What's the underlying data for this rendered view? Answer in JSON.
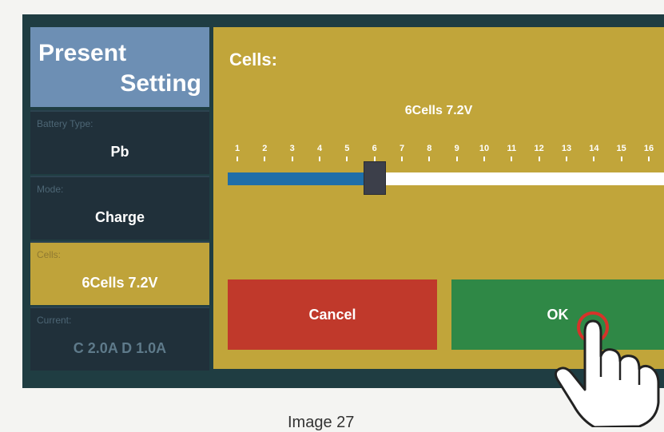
{
  "sidebar": {
    "header_line1": "Present",
    "header_line2": "Setting",
    "items": [
      {
        "label": "Battery Type:",
        "value": "Pb"
      },
      {
        "label": "Mode:",
        "value": "Charge"
      },
      {
        "label": "Cells:",
        "value": "6Cells  7.2V"
      },
      {
        "label": "Current:",
        "value": "C 2.0A  D 1.0A"
      }
    ]
  },
  "main": {
    "title": "Cells:",
    "readout": "6Cells  7.2V",
    "slider": {
      "ticks": [
        "1",
        "2",
        "3",
        "4",
        "5",
        "6",
        "7",
        "8",
        "9",
        "10",
        "11",
        "12",
        "13",
        "14",
        "15",
        "16"
      ],
      "value": 6,
      "min": 1,
      "max": 16
    },
    "cancel_label": "Cancel",
    "ok_label": "OK"
  },
  "colors": {
    "accent": "#c1a53a",
    "sidebar_header": "#6d8fb4",
    "slider_fill": "#1f6ea8",
    "cancel": "#c0392b",
    "ok": "#2f8846"
  },
  "icons": {
    "pointer": "hand-pointer-icon"
  },
  "caption": "Image 27"
}
